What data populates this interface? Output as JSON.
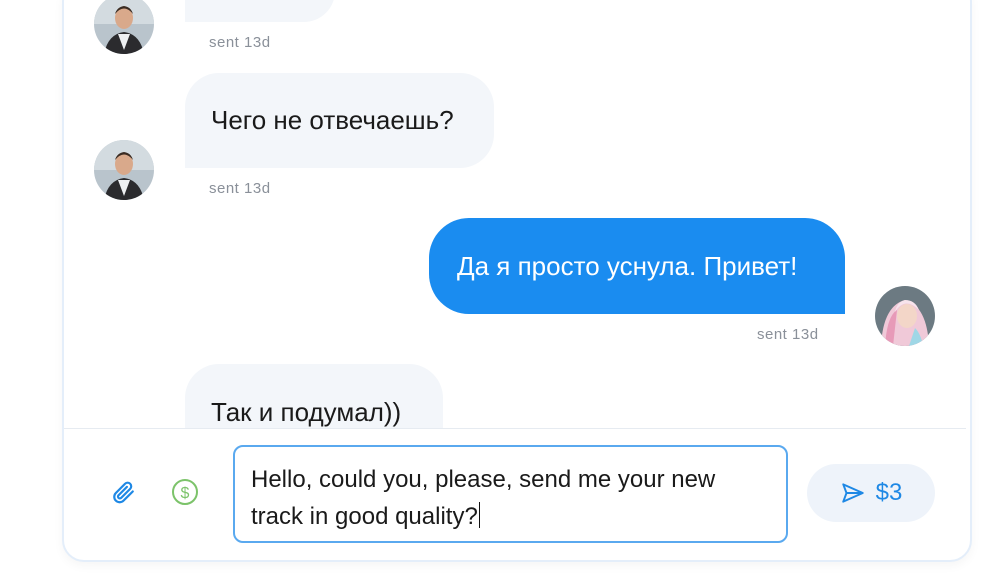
{
  "messages": [
    {
      "direction": "incoming",
      "text": "",
      "meta": "sent 13d"
    },
    {
      "direction": "incoming",
      "text": "Чего не отвечаешь?",
      "meta": "sent 13d"
    },
    {
      "direction": "outgoing",
      "text": "Да я просто уснула. Привет!",
      "meta": "sent 13d"
    },
    {
      "direction": "incoming",
      "text": "Так и подумал))",
      "meta": ""
    }
  ],
  "composer": {
    "draft": "Hello, could you, please, send me your new track in good quality?",
    "send_label": "$3"
  },
  "icons": {
    "attach": "paperclip-icon",
    "tip": "dollar-circle-icon",
    "send": "send-arrow-icon"
  },
  "colors": {
    "outgoing_bubble": "#1a8cf0",
    "incoming_bubble": "#f3f6fa",
    "accent": "#1e88e5",
    "tip_icon": "#7cc36a"
  }
}
